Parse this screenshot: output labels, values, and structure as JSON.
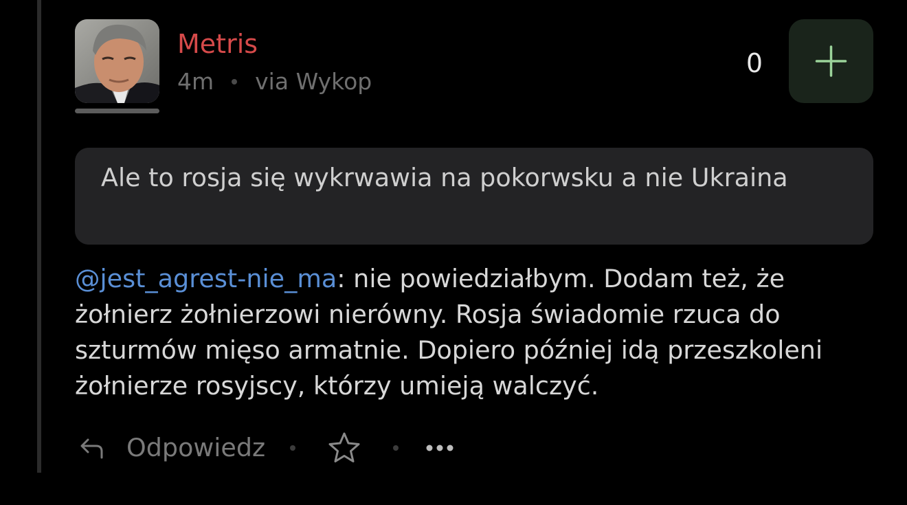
{
  "post": {
    "author": "Metris",
    "time": "4m",
    "source": "via Wykop",
    "vote_count": "0"
  },
  "quote": {
    "text": "Ale to rosja się wykrwawia na pokorwsku a nie Ukraina"
  },
  "body": {
    "mention": "@jest_agrest-nie_ma",
    "text": ": nie powiedziałbym. Dodam też, że żołnierz żołnierzowi nierówny. Rosja świadomie rzuca do szturmów mięso armatnie. Dopiero później idą przeszkoleni żołnierze rosyjscy, którzy umieją walczyć."
  },
  "actions": {
    "reply_label": "Odpowiedz"
  },
  "icons": {
    "reply": "reply-arrow-icon",
    "favorite": "star-outline-icon",
    "more": "more-dots-icon",
    "plus": "plus-icon"
  },
  "colors": {
    "background": "#000000",
    "author": "#d64a4a",
    "mention": "#5a8fd6",
    "plus_button": "#1a241b",
    "plus_glyph": "#9bd39a",
    "quote_background": "#232325"
  }
}
